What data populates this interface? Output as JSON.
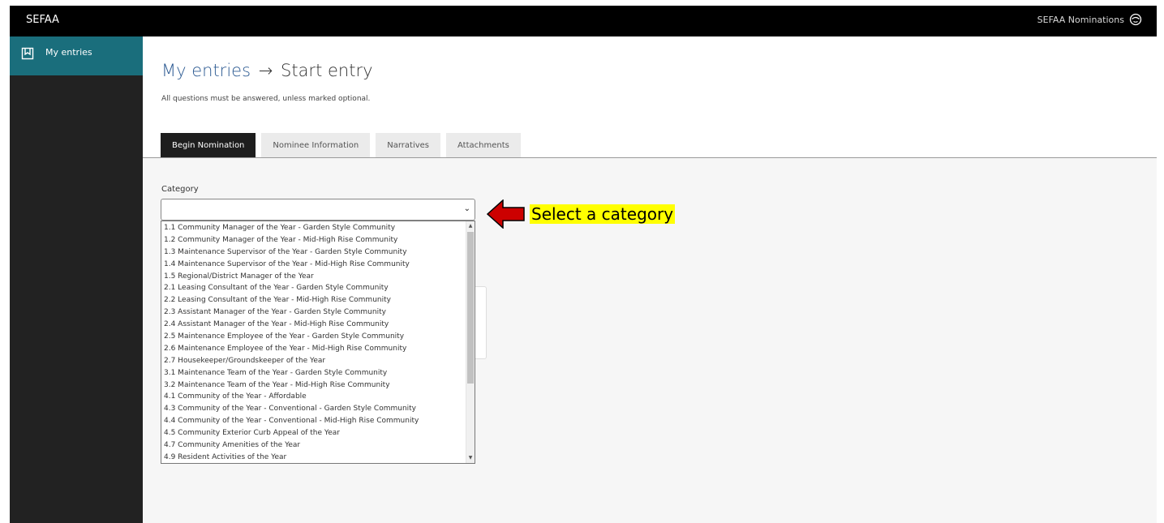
{
  "app": {
    "brand": "SEFAA",
    "user_menu": "SEFAA Nominations"
  },
  "sidebar": {
    "items": [
      {
        "label": "My entries",
        "icon": "bookmark-icon"
      }
    ]
  },
  "header": {
    "breadcrumb_parent": "My entries",
    "breadcrumb_arrow": "→",
    "breadcrumb_current": "Start entry",
    "subtitle": "All questions must be answered, unless marked optional."
  },
  "tabs": [
    {
      "label": "Begin Nomination",
      "active": true
    },
    {
      "label": "Nominee Information",
      "active": false
    },
    {
      "label": "Narratives",
      "active": false
    },
    {
      "label": "Attachments",
      "active": false
    }
  ],
  "form": {
    "category_label": "Category",
    "category_value": "",
    "options": [
      "1.1 Community Manager of the Year - Garden Style Community",
      "1.2 Community Manager of the Year - Mid-High Rise Community",
      "1.3 Maintenance Supervisor of the Year - Garden Style Community",
      "1.4 Maintenance Supervisor of the Year - Mid-High Rise Community",
      "1.5 Regional/District Manager of the Year",
      "2.1 Leasing Consultant of the Year - Garden Style Community",
      "2.2 Leasing Consultant of the Year - Mid-High Rise Community",
      "2.3 Assistant Manager of the Year - Garden Style Community",
      "2.4 Assistant Manager of the Year - Mid-High Rise Community",
      "2.5 Maintenance Employee of the Year - Garden Style Community",
      "2.6 Maintenance Employee of the Year - Mid-High Rise Community",
      "2.7 Housekeeper/Groundskeeper of the Year",
      "3.1 Maintenance Team of the Year - Garden Style Community",
      "3.2 Maintenance Team of the Year - Mid-High Rise Community",
      "4.1 Community of the Year - Affordable",
      "4.3 Community of the Year - Conventional - Garden Style Community",
      "4.4 Community of the Year - Conventional - Mid-High Rise Community",
      "4.5 Community Exterior Curb Appeal of the Year",
      "4.7 Community Amenities of the Year",
      "4.9 Resident Activities of the Year"
    ]
  },
  "annotation": {
    "text": "Select a category",
    "highlight_color": "#ffff00",
    "arrow_color": "#cc0000"
  },
  "colors": {
    "accent": "#1a6e7c",
    "topbar": "#000000",
    "sidebar": "#222222",
    "title": "#2c5a92"
  }
}
